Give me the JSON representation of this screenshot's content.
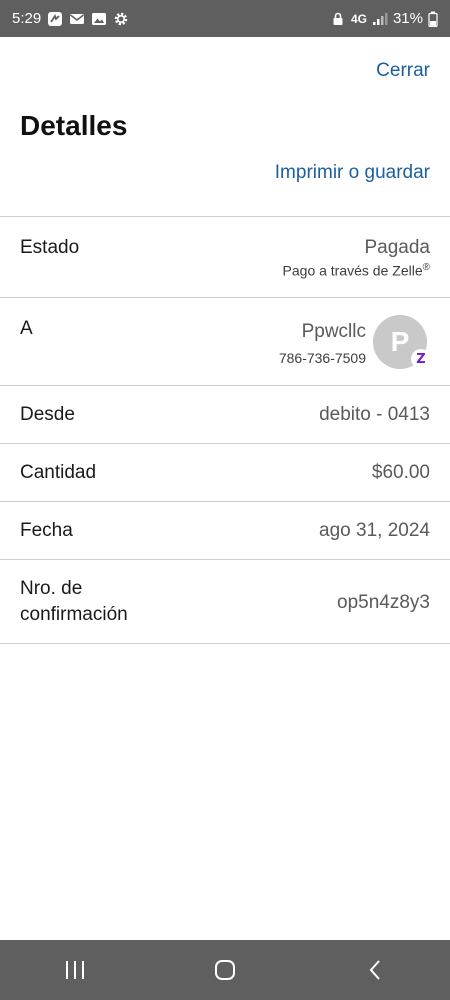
{
  "status_bar": {
    "time": "5:29",
    "network": "4G",
    "battery": "31%"
  },
  "header": {
    "close_label": "Cerrar",
    "title": "Detalles",
    "print_label": "Imprimir o guardar"
  },
  "details": {
    "estado": {
      "label": "Estado",
      "value": "Pagada",
      "sub": "Pago a través de Zelle",
      "sub_mark": "®"
    },
    "a": {
      "label": "A",
      "name": "Ppwcllc",
      "phone": "786-736-7509",
      "avatar_initial": "P",
      "badge": "Z"
    },
    "desde": {
      "label": "Desde",
      "value": "debito - 0413"
    },
    "cantidad": {
      "label": "Cantidad",
      "value": "$60.00"
    },
    "fecha": {
      "label": "Fecha",
      "value": "ago 31, 2024"
    },
    "confirmacion": {
      "label_line1": "Nro. de",
      "label_line2": "confirmación",
      "value": "op5n4z8y3"
    }
  },
  "colors": {
    "link": "#1b5f9e",
    "zelle": "#6d1ed4",
    "bars": "#5f5f5f"
  },
  "icons": [
    "app-icon",
    "mail-icon",
    "image-icon",
    "settings-gear-icon",
    "lock-icon",
    "signal-icon",
    "battery-icon",
    "recents-icon",
    "home-icon",
    "back-icon"
  ]
}
